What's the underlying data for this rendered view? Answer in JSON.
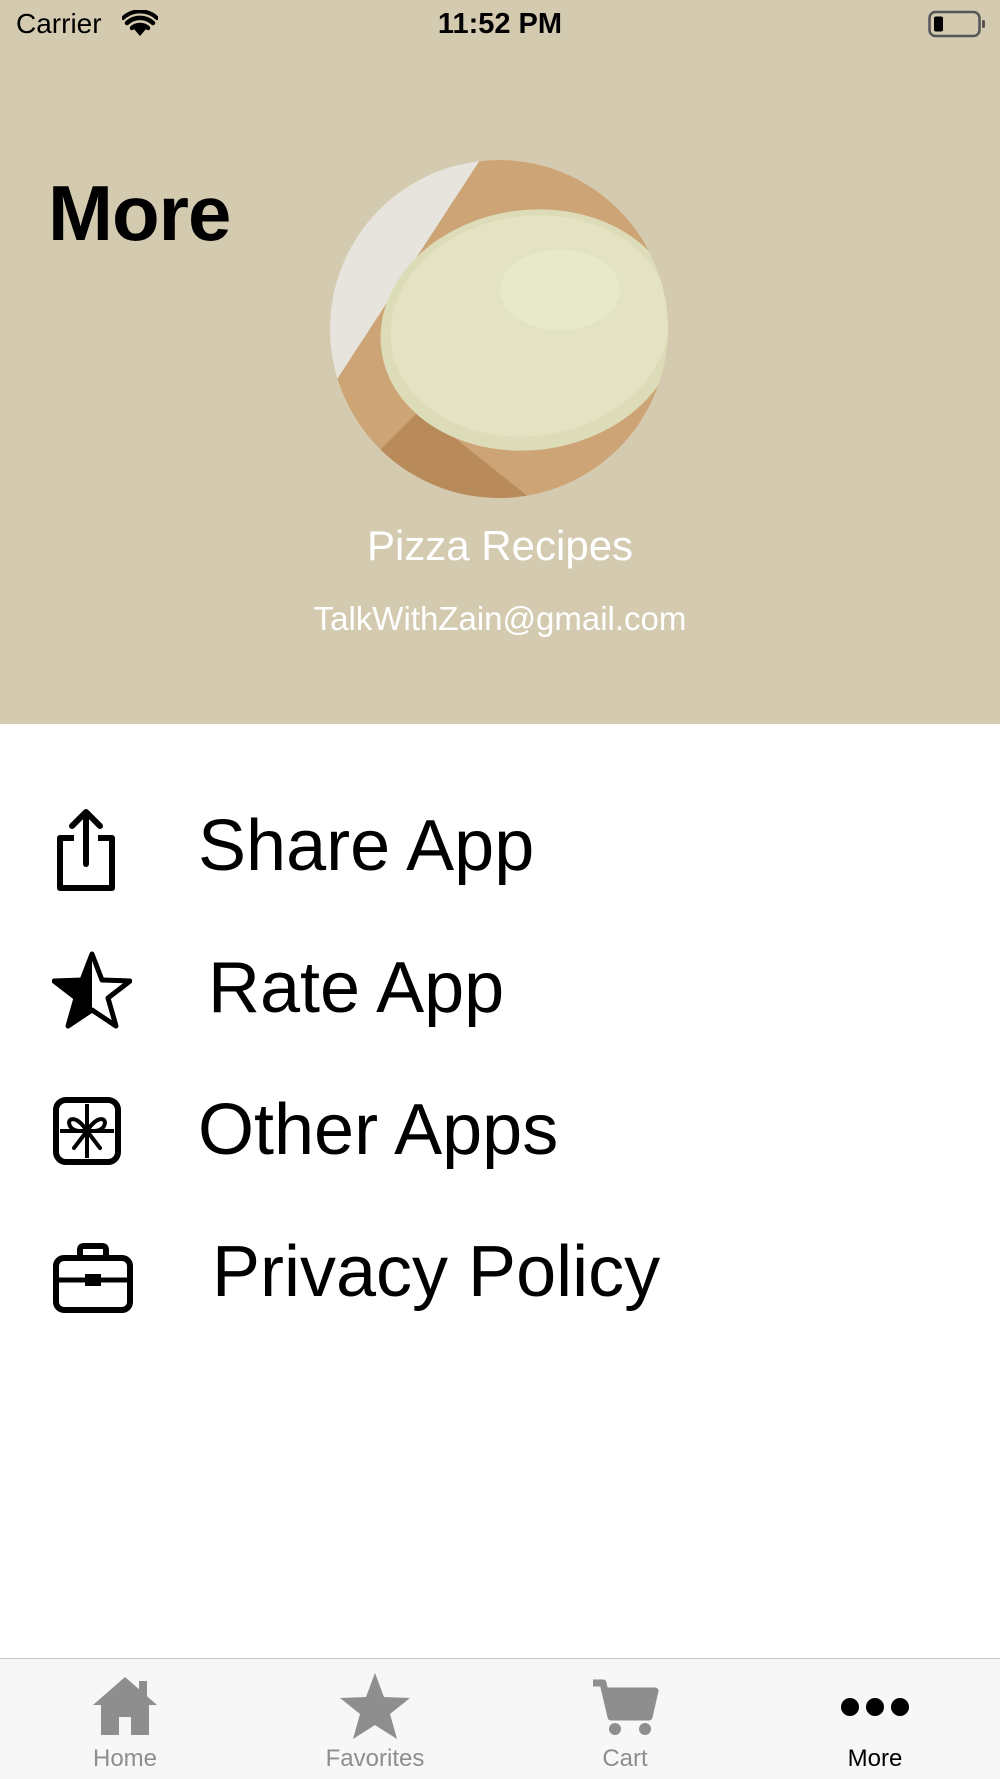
{
  "status_bar": {
    "carrier": "Carrier",
    "time": "11:52 PM"
  },
  "header": {
    "title": "More",
    "background_color": "#d3cab0",
    "profile_name": "Pizza Recipes",
    "profile_email": "TalkWithZain@gmail.com"
  },
  "menu": {
    "items": [
      {
        "label": "Share App",
        "icon": "share-icon"
      },
      {
        "label": "Rate App",
        "icon": "star-half-icon"
      },
      {
        "label": "Other Apps",
        "icon": "gift-icon"
      },
      {
        "label": "Privacy Policy",
        "icon": "briefcase-icon"
      }
    ]
  },
  "tab_bar": {
    "tabs": [
      {
        "label": "Home",
        "icon": "house-icon",
        "active": false
      },
      {
        "label": "Favorites",
        "icon": "star-icon",
        "active": false
      },
      {
        "label": "Cart",
        "icon": "cart-icon",
        "active": false
      },
      {
        "label": "More",
        "icon": "ellipsis-icon",
        "active": true
      }
    ],
    "active_color": "#000000",
    "inactive_color": "#8e8e8e"
  }
}
